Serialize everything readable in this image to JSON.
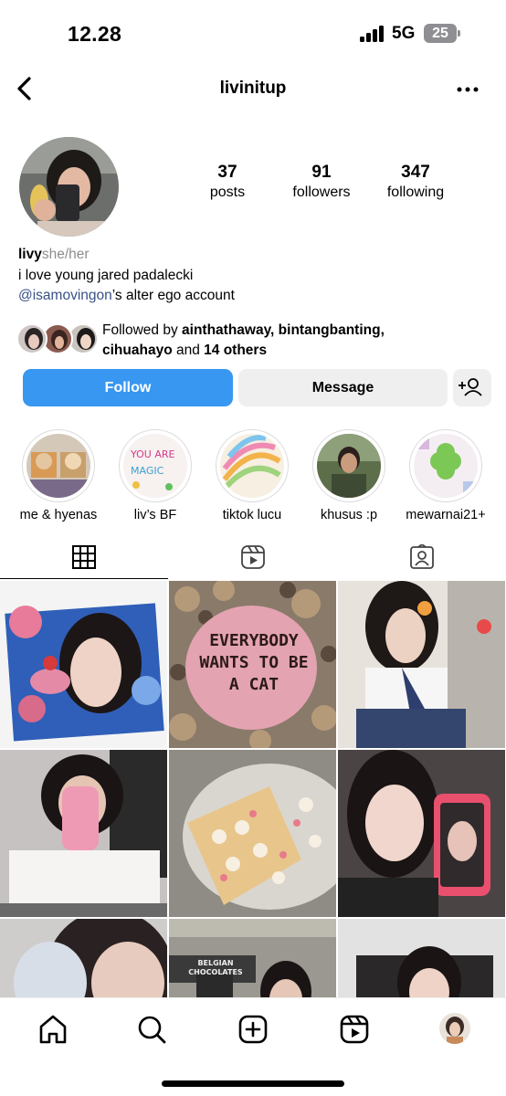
{
  "status_bar": {
    "time": "12.28",
    "network": "5G",
    "battery": "25"
  },
  "header": {
    "username": "livinitup",
    "back_icon": "chevron-left-icon",
    "more_icon": "ellipsis-icon"
  },
  "stats": [
    {
      "value": "37",
      "label": "posts"
    },
    {
      "value": "91",
      "label": "followers"
    },
    {
      "value": "347",
      "label": "following"
    }
  ],
  "bio": {
    "name": "livy",
    "pronouns": "she/her",
    "line1": "i love young jared padalecki",
    "mention": "@isamovingon",
    "mention_suffix": "’s alter ego account"
  },
  "followed_by": {
    "prefix": "Followed by ",
    "names": "ainthathaway, bintangbanting,",
    "name3": "cihuahayo",
    "joiner": " and ",
    "others": "14 others"
  },
  "actions": {
    "follow": "Follow",
    "message": "Message",
    "suggest_icon": "add-person-icon"
  },
  "highlights": [
    {
      "label": "me & hyenas"
    },
    {
      "label": "liv’s BF"
    },
    {
      "label": "tiktok lucu"
    },
    {
      "label": "khusus :p"
    },
    {
      "label": "mewarnai21+"
    }
  ],
  "tabs": [
    {
      "name": "grid-icon",
      "active": true
    },
    {
      "name": "reels-icon",
      "active": false
    },
    {
      "name": "tagged-icon",
      "active": false
    }
  ],
  "posts": [
    {
      "text": ""
    },
    {
      "text": "EVERYBODY WANTS TO BE A CAT"
    },
    {
      "text": ""
    },
    {
      "text": ""
    },
    {
      "text": ""
    },
    {
      "text": ""
    },
    {
      "text": ""
    },
    {
      "text": "BELGIAN CHOCOLATES"
    },
    {
      "text": ""
    }
  ],
  "nav": [
    "home-icon",
    "search-icon",
    "create-icon",
    "reels-icon",
    "profile-avatar"
  ],
  "colors": {
    "accent": "#3897f0",
    "button_gray": "#efefef",
    "mention": "#385185"
  }
}
